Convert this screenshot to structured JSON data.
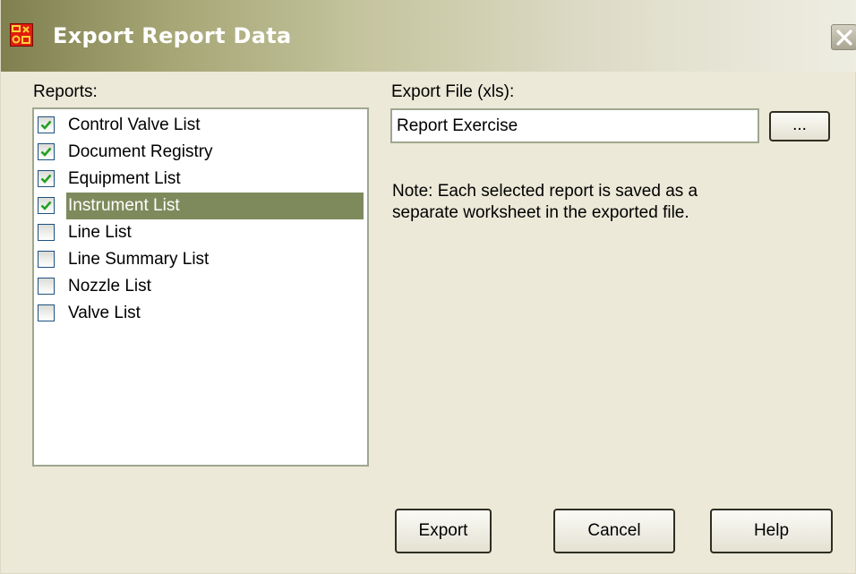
{
  "window": {
    "title": "Export Report Data"
  },
  "reports": {
    "label": "Reports:",
    "items": [
      {
        "label": "Control Valve List",
        "checked": true,
        "selected": false
      },
      {
        "label": "Document Registry",
        "checked": true,
        "selected": false
      },
      {
        "label": "Equipment List",
        "checked": true,
        "selected": false
      },
      {
        "label": "Instrument List",
        "checked": true,
        "selected": true
      },
      {
        "label": "Line List",
        "checked": false,
        "selected": false
      },
      {
        "label": "Line Summary List",
        "checked": false,
        "selected": false
      },
      {
        "label": "Nozzle List",
        "checked": false,
        "selected": false
      },
      {
        "label": "Valve List",
        "checked": false,
        "selected": false
      }
    ]
  },
  "export_file": {
    "label": "Export File (xls):",
    "value": "Report Exercise",
    "browse_label": "..."
  },
  "note": "Note: Each selected report is saved as a separate worksheet in the exported file.",
  "buttons": {
    "export": "Export",
    "cancel": "Cancel",
    "help": "Help"
  },
  "icons": {
    "app": "app-logo-icon",
    "close": "close-icon",
    "check": "checkmark-icon"
  },
  "colors": {
    "selection": "#7f8a5c",
    "check": "#21a121",
    "close_x": "#ffffff"
  }
}
